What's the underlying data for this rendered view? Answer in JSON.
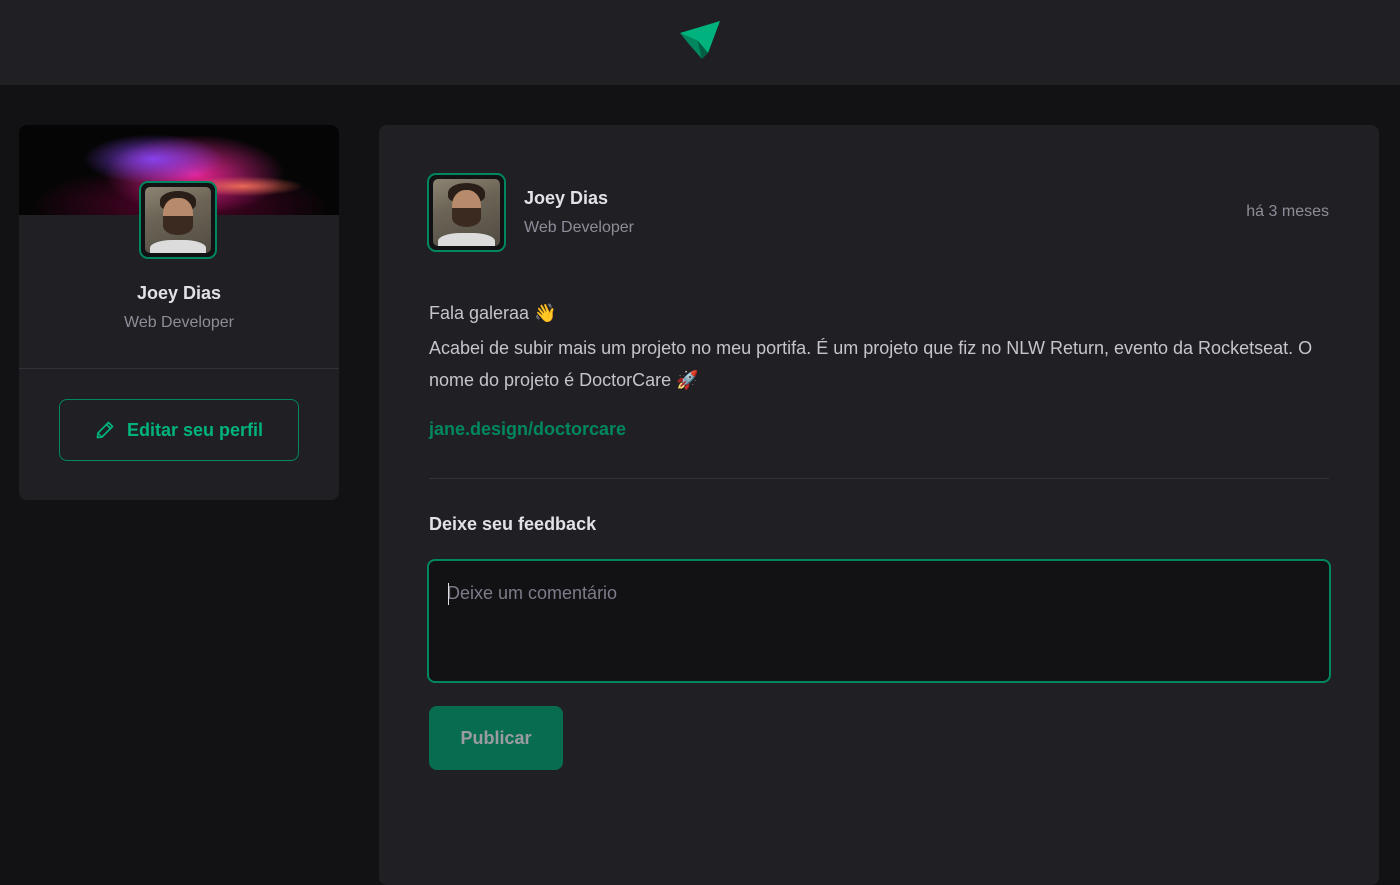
{
  "brand": {
    "logo_icon": "paper-plane-logo-icon",
    "accent": "#00875f",
    "accent_light": "#00b37e"
  },
  "sidebar": {
    "name": "Joey Dias",
    "role": "Web Developer",
    "edit_label": "Editar seu perfil",
    "edit_icon": "pencil-icon"
  },
  "post": {
    "author": {
      "name": "Joey Dias",
      "role": "Web Developer"
    },
    "time": "há 3 meses",
    "greeting": "Fala galeraa 👋",
    "body": "Acabei de subir mais um projeto no meu portifa. É um projeto que fiz no NLW Return, evento da Rocketseat. O nome do projeto é DoctorCare 🚀",
    "link": "jane.design/doctorcare"
  },
  "feedback": {
    "title": "Deixe seu feedback",
    "placeholder": "Deixe um comentário",
    "value": "",
    "submit_label": "Publicar"
  }
}
